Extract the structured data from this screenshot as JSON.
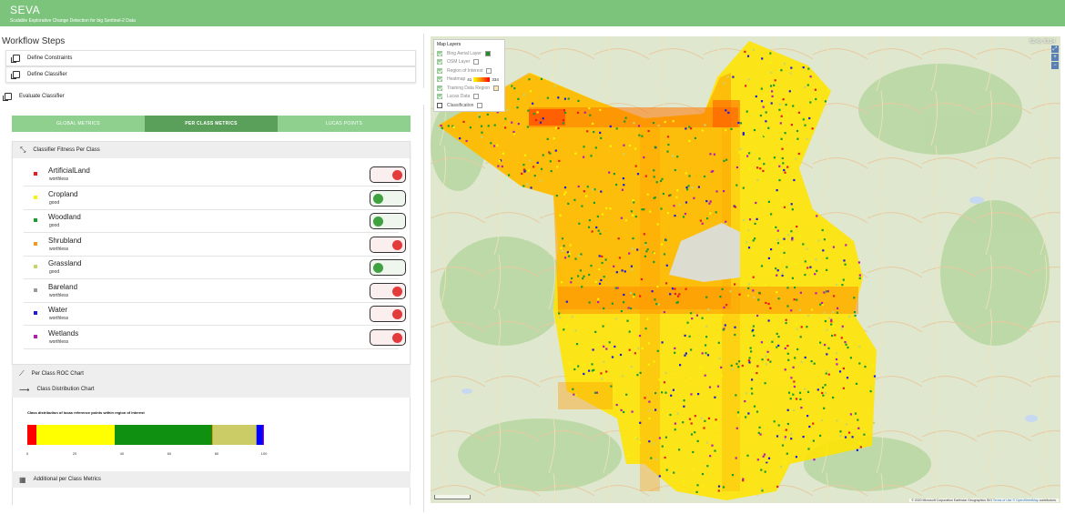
{
  "header": {
    "title": "SEVA",
    "subtitle": "Scalable Explorative Change Detection for big Sentinel-2 Data"
  },
  "workflow": {
    "title": "Workflow Steps",
    "steps": [
      {
        "label": "Define Constraints"
      },
      {
        "label": "Define Classifier"
      },
      {
        "label": "Evaluate Classifier"
      }
    ]
  },
  "tabs": [
    {
      "label": "GLOBAL METRICS",
      "active": false
    },
    {
      "label": "PER CLASS METRICS",
      "active": true
    },
    {
      "label": "LUCAS POINTS",
      "active": false
    }
  ],
  "fitness": {
    "title": "Classifier Fitness Per Class",
    "classes": [
      {
        "name": "ArtificialLand",
        "status": "worthless",
        "color": "#e81c1c",
        "good": false
      },
      {
        "name": "Cropland",
        "status": "good",
        "color": "#f5f50a",
        "good": true
      },
      {
        "name": "Woodland",
        "status": "good",
        "color": "#1c9c2c",
        "good": true
      },
      {
        "name": "Shrubland",
        "status": "worthless",
        "color": "#f29a1c",
        "good": false
      },
      {
        "name": "Grassland",
        "status": "good",
        "color": "#c8d46a",
        "good": true
      },
      {
        "name": "Bareland",
        "status": "worthless",
        "color": "#9a9a9a",
        "good": false
      },
      {
        "name": "Water",
        "status": "worthless",
        "color": "#1c1cd8",
        "good": false
      },
      {
        "name": "Wetlands",
        "status": "worthless",
        "color": "#b41cb4",
        "good": false
      }
    ]
  },
  "sections": {
    "roc": "Per Class ROC Chart",
    "distribution": "Class Distribution Chart",
    "additional": "Additional per Class Metrics"
  },
  "chart_data": {
    "type": "bar",
    "title": "Class distribution of lucas reference points within region of interest",
    "xlim": [
      0,
      100
    ],
    "ticks": [
      "0",
      "20",
      "40",
      "60",
      "80",
      "100"
    ],
    "series": [
      {
        "name": "ArtificialLand",
        "value": 4,
        "color": "#ff0000"
      },
      {
        "name": "Cropland",
        "value": 33,
        "color": "#ffff00"
      },
      {
        "name": "Woodland",
        "value": 41,
        "color": "#109010"
      },
      {
        "name": "Shrubland",
        "value": 0.5,
        "color": "#ff9900"
      },
      {
        "name": "Grassland",
        "value": 18,
        "color": "#cccc66"
      },
      {
        "name": "Bareland",
        "value": 0.5,
        "color": "#999999"
      },
      {
        "name": "Water",
        "value": 2.5,
        "color": "#0000ff"
      },
      {
        "name": "Wetlands",
        "value": 0.5,
        "color": "#aa00aa"
      }
    ]
  },
  "map": {
    "layers_title": "Map Layers",
    "layers": [
      {
        "label": "Bing Aerial Layer",
        "checked": true,
        "swatch": "#2a8a2a"
      },
      {
        "label": "OSM Layer",
        "checked": true,
        "swatch": "#ffffff"
      },
      {
        "label": "Region of Interest",
        "checked": true,
        "swatch": "#ffffff"
      },
      {
        "label": "Heatmap",
        "checked": true
      },
      {
        "label": "Training Data Region",
        "checked": true,
        "swatch": "#ffe9a8"
      },
      {
        "label": "Lucas Data",
        "checked": true,
        "swatch": "#ffffff"
      },
      {
        "label": "Classification",
        "checked": false,
        "swatch": "#ffffff"
      }
    ],
    "heat_min": "41",
    "heat_max": "334",
    "coords": "52.49, 53.14",
    "attribution_text": "© 2020 Microsoft Corporation Earthstar Geographics SIO",
    "terms_link": "Terms of Use",
    "osm_link": "© OpenStreetMap",
    "contributors": "contributors."
  }
}
